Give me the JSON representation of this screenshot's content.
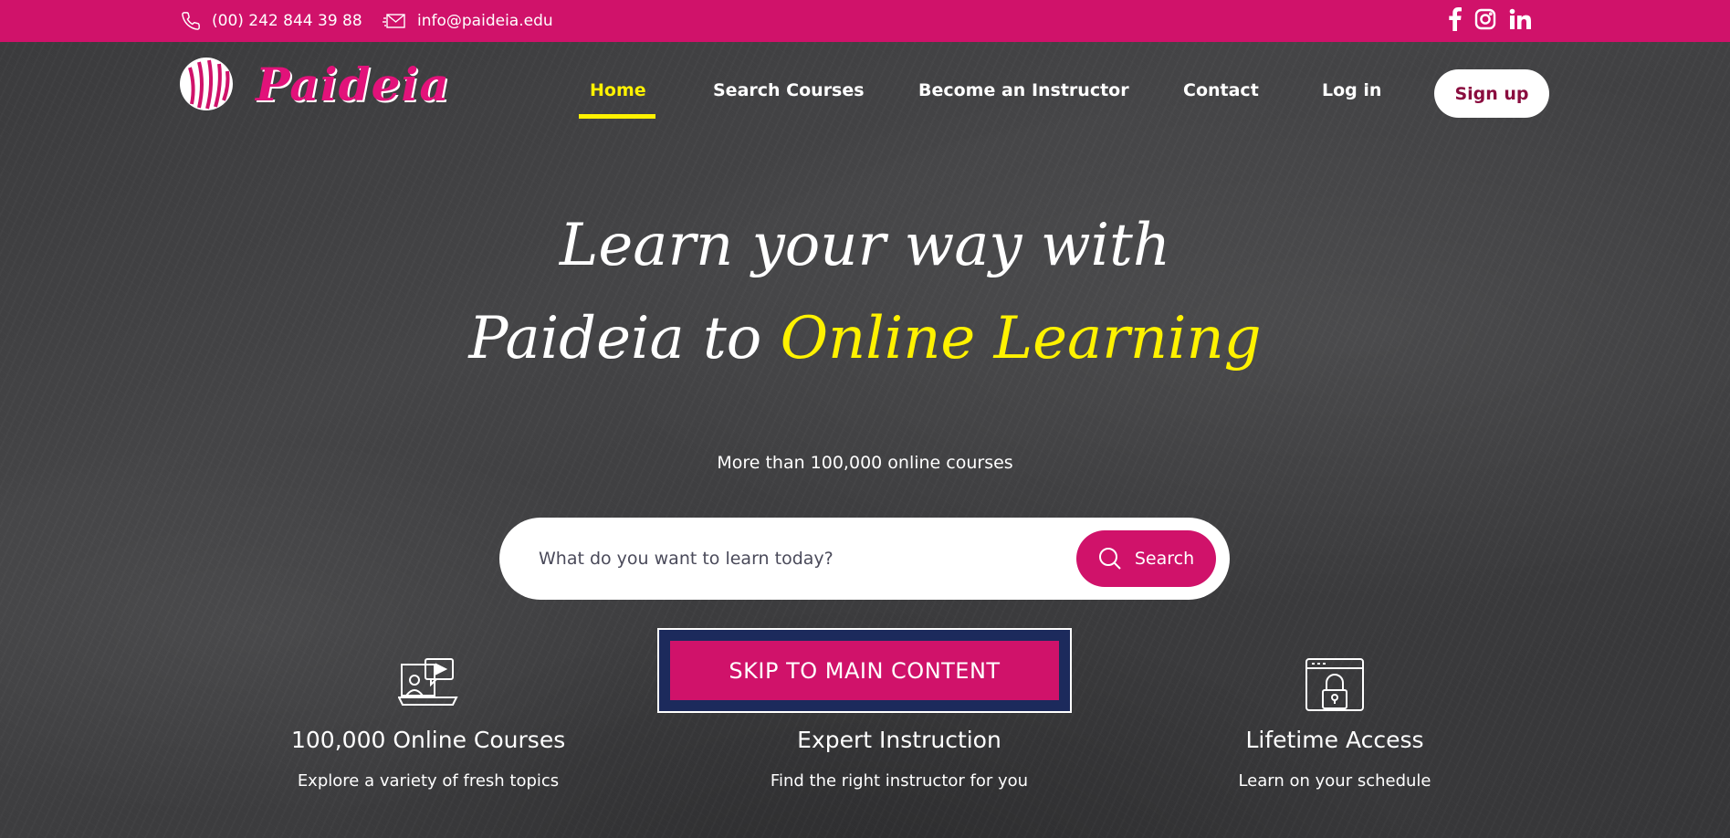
{
  "topbar": {
    "phone": "(00) 242 844 39 88",
    "email": "info@paideia.edu",
    "social": [
      "facebook-icon",
      "instagram-icon",
      "linkedin-icon"
    ]
  },
  "brand": {
    "name": "Paideia"
  },
  "nav": {
    "items": [
      {
        "label": "Home",
        "active": true
      },
      {
        "label": "Search Courses"
      },
      {
        "label": "Become an Instructor"
      },
      {
        "label": "Contact"
      },
      {
        "label": "Log in"
      }
    ],
    "signup": "Sign up"
  },
  "hero": {
    "line1": "Learn your way with",
    "line2_prefix": "Paideia to ",
    "line2_highlight": "Online Learning",
    "subtitle": "More than 100,000 online courses"
  },
  "search": {
    "placeholder": "What do you want to learn today?",
    "button": "Search"
  },
  "skip_link": "SKIP TO MAIN CONTENT",
  "features": [
    {
      "icon": "online-courses-icon",
      "title": "100,000 Online Courses",
      "desc": "Explore a variety of fresh topics"
    },
    {
      "icon": "expert-instruction-icon",
      "title": "Expert Instruction",
      "desc": "Find the right instructor for you"
    },
    {
      "icon": "lifetime-access-icon",
      "title": "Lifetime Access",
      "desc": "Learn on your schedule"
    }
  ],
  "colors": {
    "brand_pink": "#d0126a",
    "highlight_yellow": "#fff200",
    "skip_navy": "#1c2a5c"
  }
}
